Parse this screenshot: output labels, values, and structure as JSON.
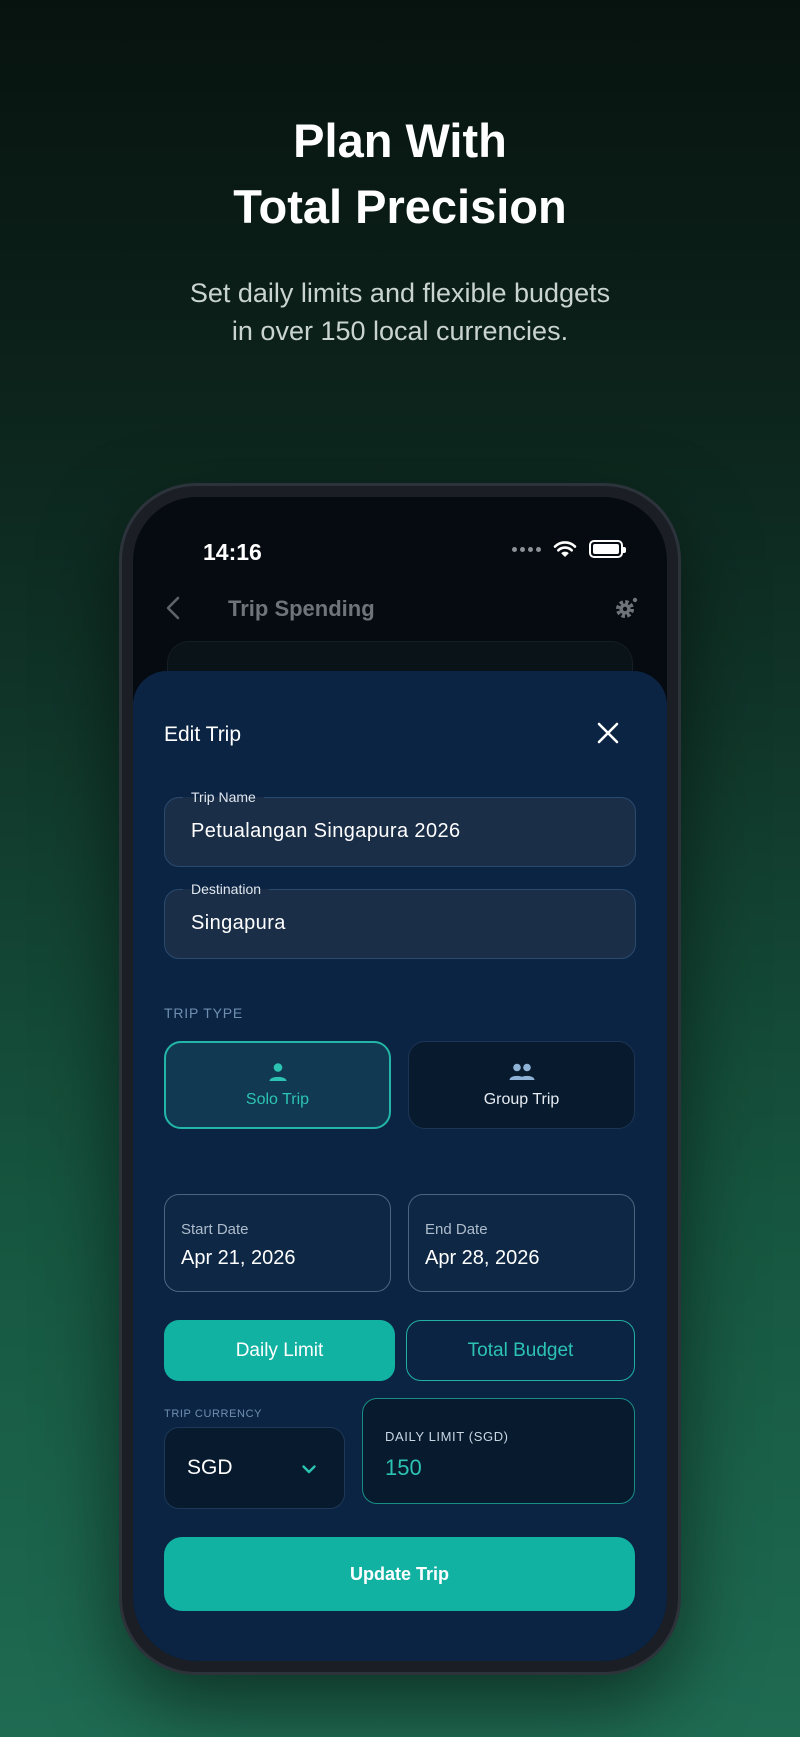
{
  "hero": {
    "title_line1": "Plan With",
    "title_line2": "Total Precision",
    "subtitle_line1": "Set daily limits and flexible budgets",
    "subtitle_line2": "in over 150 local currencies."
  },
  "status_bar": {
    "time": "14:16"
  },
  "nav": {
    "title": "Trip Spending"
  },
  "sheet": {
    "title": "Edit Trip",
    "trip_name": {
      "label": "Trip Name",
      "value": "Petualangan Singapura 2026"
    },
    "destination": {
      "label": "Destination",
      "value": "Singapura"
    },
    "trip_type": {
      "label": "TRIP TYPE",
      "options": [
        {
          "label": "Solo Trip",
          "selected": true
        },
        {
          "label": "Group Trip",
          "selected": false
        }
      ]
    },
    "start_date": {
      "label": "Start Date",
      "value": "Apr 21, 2026"
    },
    "end_date": {
      "label": "End Date",
      "value": "Apr 28, 2026"
    },
    "budget_modes": {
      "daily_label": "Daily Limit",
      "total_label": "Total Budget",
      "selected": "Daily Limit"
    },
    "currency": {
      "label": "TRIP CURRENCY",
      "value": "SGD"
    },
    "daily_limit": {
      "label": "DAILY LIMIT (SGD)",
      "value": "150"
    },
    "submit_label": "Update Trip"
  },
  "colors": {
    "accent": "#12b2a3",
    "sheet_bg": "#0c2444",
    "field_bg": "#1a2e48"
  }
}
